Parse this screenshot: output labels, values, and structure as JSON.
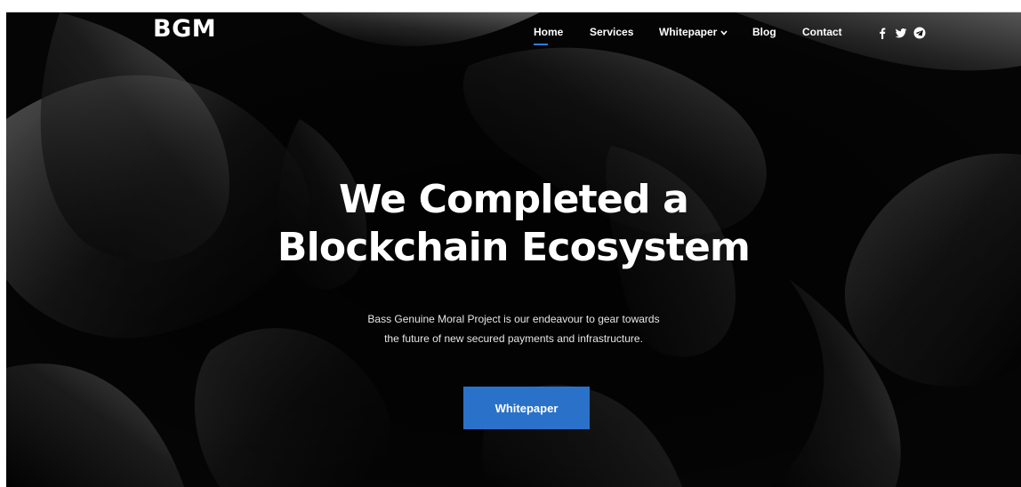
{
  "brand": {
    "logo_text": "BGM"
  },
  "nav": {
    "items": [
      {
        "label": "Home",
        "active": true
      },
      {
        "label": "Services"
      },
      {
        "label": "Whitepaper",
        "has_dropdown": true
      },
      {
        "label": "Blog"
      },
      {
        "label": "Contact"
      }
    ]
  },
  "social": [
    "facebook-icon",
    "twitter-icon",
    "telegram-icon"
  ],
  "hero": {
    "title_line1": "We Completed a",
    "title_line2": "Blockchain Ecosystem",
    "subtitle_line1": "Bass Genuine Moral Project is our endeavour to gear towards",
    "subtitle_line2": "the future of new secured payments and infrastructure.",
    "cta_label": "Whitepaper"
  },
  "colors": {
    "accent": "#2a72c9",
    "nav_underline": "#2f7fd8",
    "background": "#000000",
    "text": "#ffffff"
  }
}
